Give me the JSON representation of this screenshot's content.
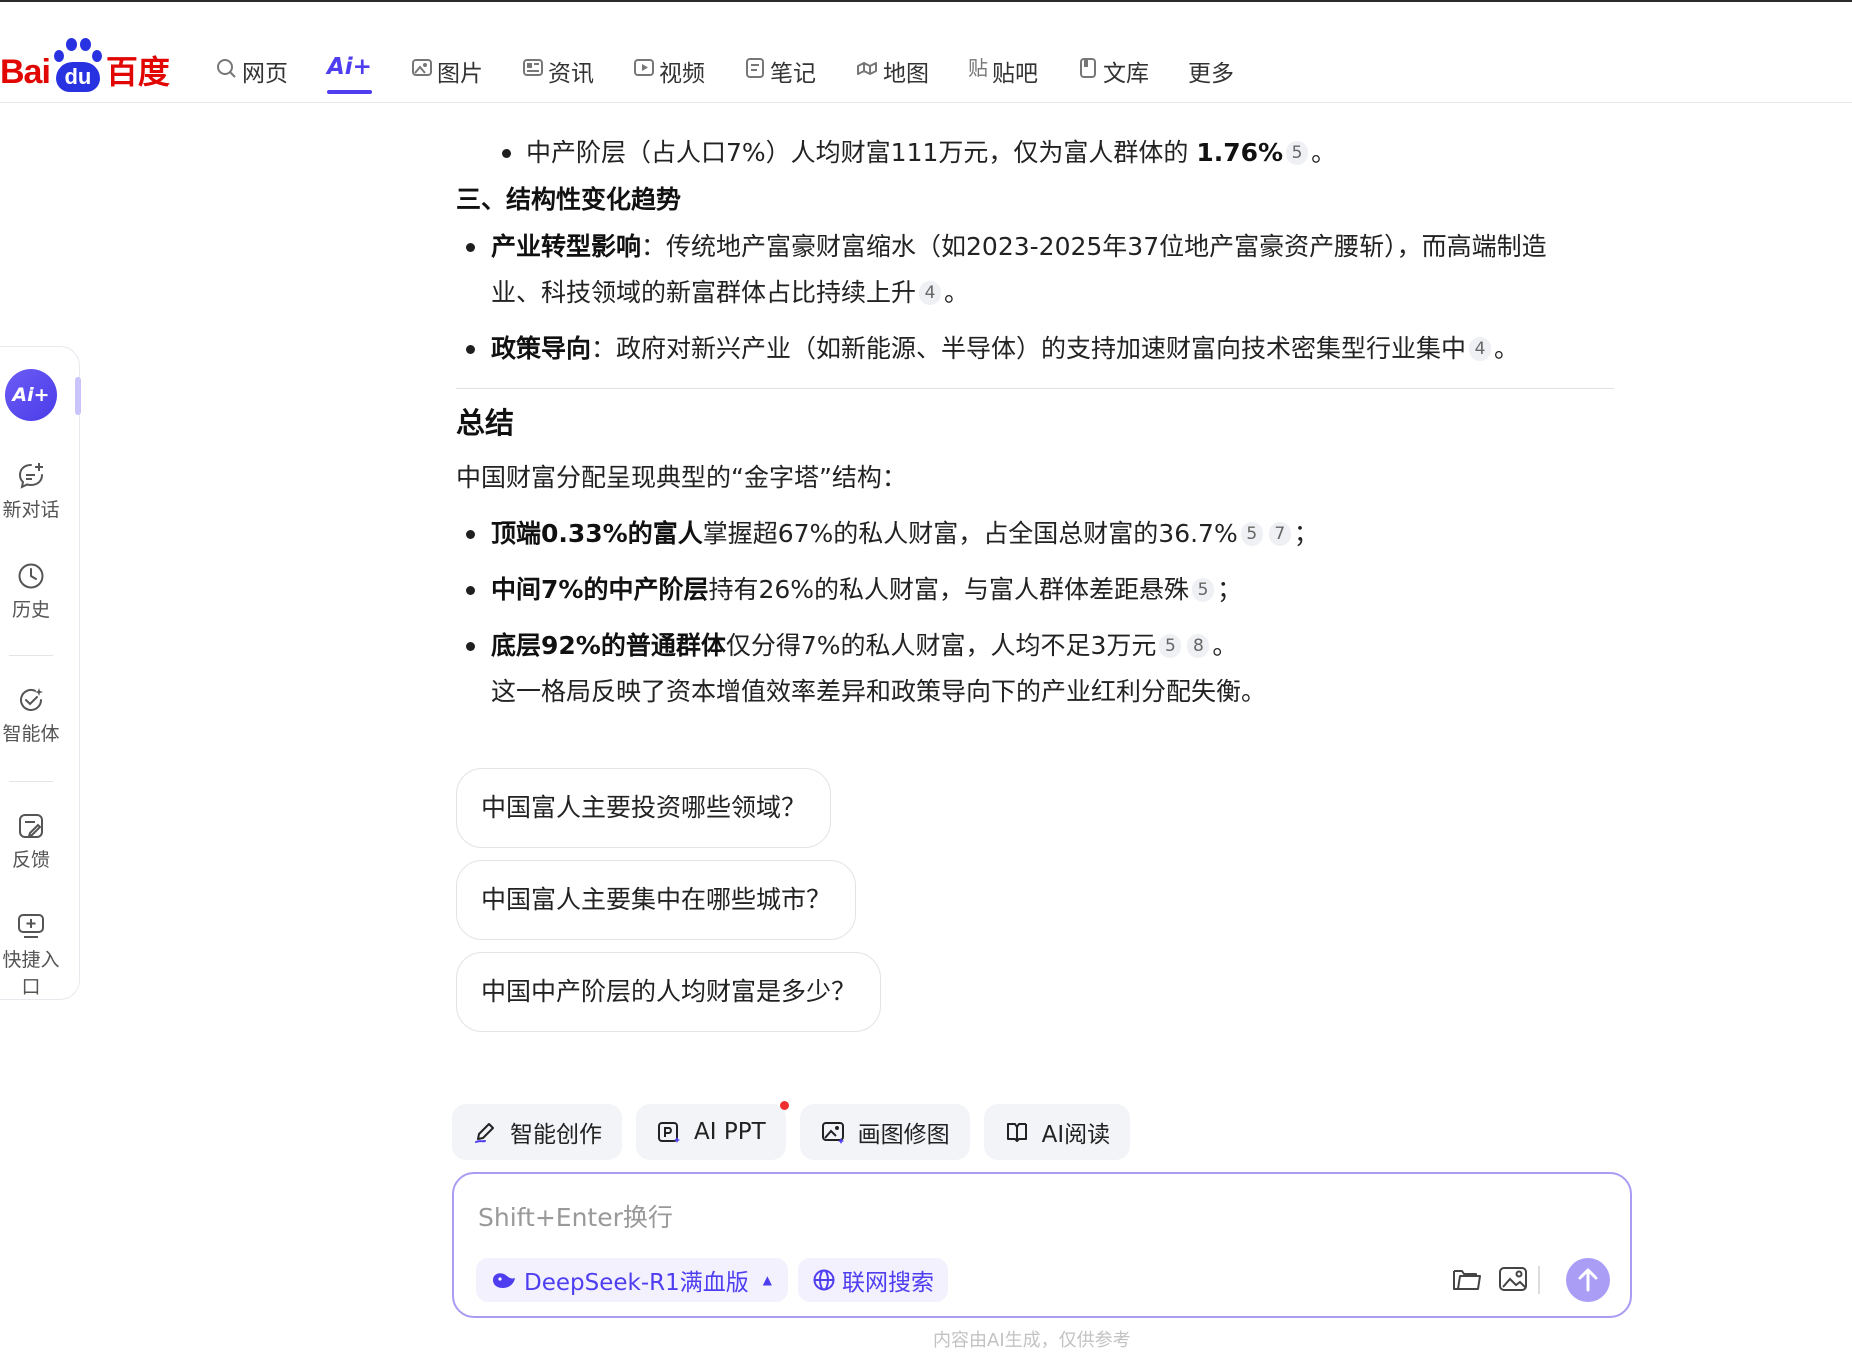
{
  "header": {
    "logo_text": "Bai",
    "logo_du": "du",
    "logo_cn": "百度",
    "nav": [
      {
        "label": "网页",
        "icon": "search-icon"
      },
      {
        "label": "Ai+",
        "icon": "ai-icon"
      },
      {
        "label": "图片",
        "icon": "image-icon"
      },
      {
        "label": "资讯",
        "icon": "news-icon"
      },
      {
        "label": "视频",
        "icon": "video-icon"
      },
      {
        "label": "笔记",
        "icon": "note-icon"
      },
      {
        "label": "地图",
        "icon": "map-icon"
      },
      {
        "label": "贴吧",
        "icon": "tieba-icon"
      },
      {
        "label": "文库",
        "icon": "library-icon"
      },
      {
        "label": "更多",
        "icon": ""
      }
    ]
  },
  "sidebar": {
    "ai_badge": "Ai+",
    "items": [
      {
        "label": "新对话",
        "icon": "new-chat-icon"
      },
      {
        "label": "历史",
        "icon": "clock-icon"
      },
      {
        "label": "智能体",
        "icon": "agent-icon"
      },
      {
        "label": "反馈",
        "icon": "feedback-icon"
      },
      {
        "label": "快捷入口",
        "icon": "shortcut-icon"
      }
    ]
  },
  "answer": {
    "l1_text": "中产阶层（占人口7%）人均财富111万元，仅为富人群体的 ",
    "l1_bold": "1.76%",
    "l1_cite": "5",
    "l1_end": "。",
    "h3": "三、结构性变化趋势",
    "b1_bold": "产业转型影响",
    "b1_text": "：传统地产富豪财富缩水（如2023-2025年37位地产富豪资产腰斩），而高端制造",
    "b1_text2": "业、科技领域的新富群体占比持续上升",
    "b1_cite": "4",
    "b1_end": "。",
    "b2_bold": "政策导向",
    "b2_text": "：政府对新兴产业（如新能源、半导体）的支持加速财富向技术密集型行业集中",
    "b2_cite": "4",
    "b2_end": "。",
    "summary_title": "总结",
    "summary_intro": "中国财富分配呈现典型的“金字塔”结构：",
    "s1_bold": "顶端0.33%的富人",
    "s1_text": "掌握超67%的私人财富，占全国总财富的36.7%",
    "s1_cite1": "5",
    "s1_cite2": "7",
    "s1_end": "；",
    "s2_bold": "中间7%的中产阶层",
    "s2_text": "持有26%的私人财富，与富人群体差距悬殊",
    "s2_cite": "5",
    "s2_end": "；",
    "s3_bold": "底层92%的普通群体",
    "s3_text": "仅分得7%的私人财富，人均不足3万元",
    "s3_cite1": "5",
    "s3_cite2": "8",
    "s3_end": "。",
    "closing": "这一格局反映了资本增值效率差异和政策导向下的产业红利分配失衡。"
  },
  "suggestions": [
    "中国富人主要投资哪些领域？",
    "中国富人主要集中在哪些城市？",
    "中国中产阶层的人均财富是多少？"
  ],
  "tools": [
    {
      "label": "智能创作",
      "icon": "pen-icon"
    },
    {
      "label": "AI PPT",
      "icon": "ppt-icon"
    },
    {
      "label": "画图修图",
      "icon": "picture-edit-icon"
    },
    {
      "label": "AI阅读",
      "icon": "book-icon"
    }
  ],
  "input": {
    "placeholder": "Shift+Enter换行",
    "model": "DeepSeek-R1满血版",
    "web_search": "联网搜索"
  },
  "footer": {
    "disclaimer": "内容由AI生成，仅供参考"
  },
  "colors": {
    "brand_red": "#e10601",
    "brand_blue": "#2932e1",
    "accent": "#4e3ef0"
  }
}
